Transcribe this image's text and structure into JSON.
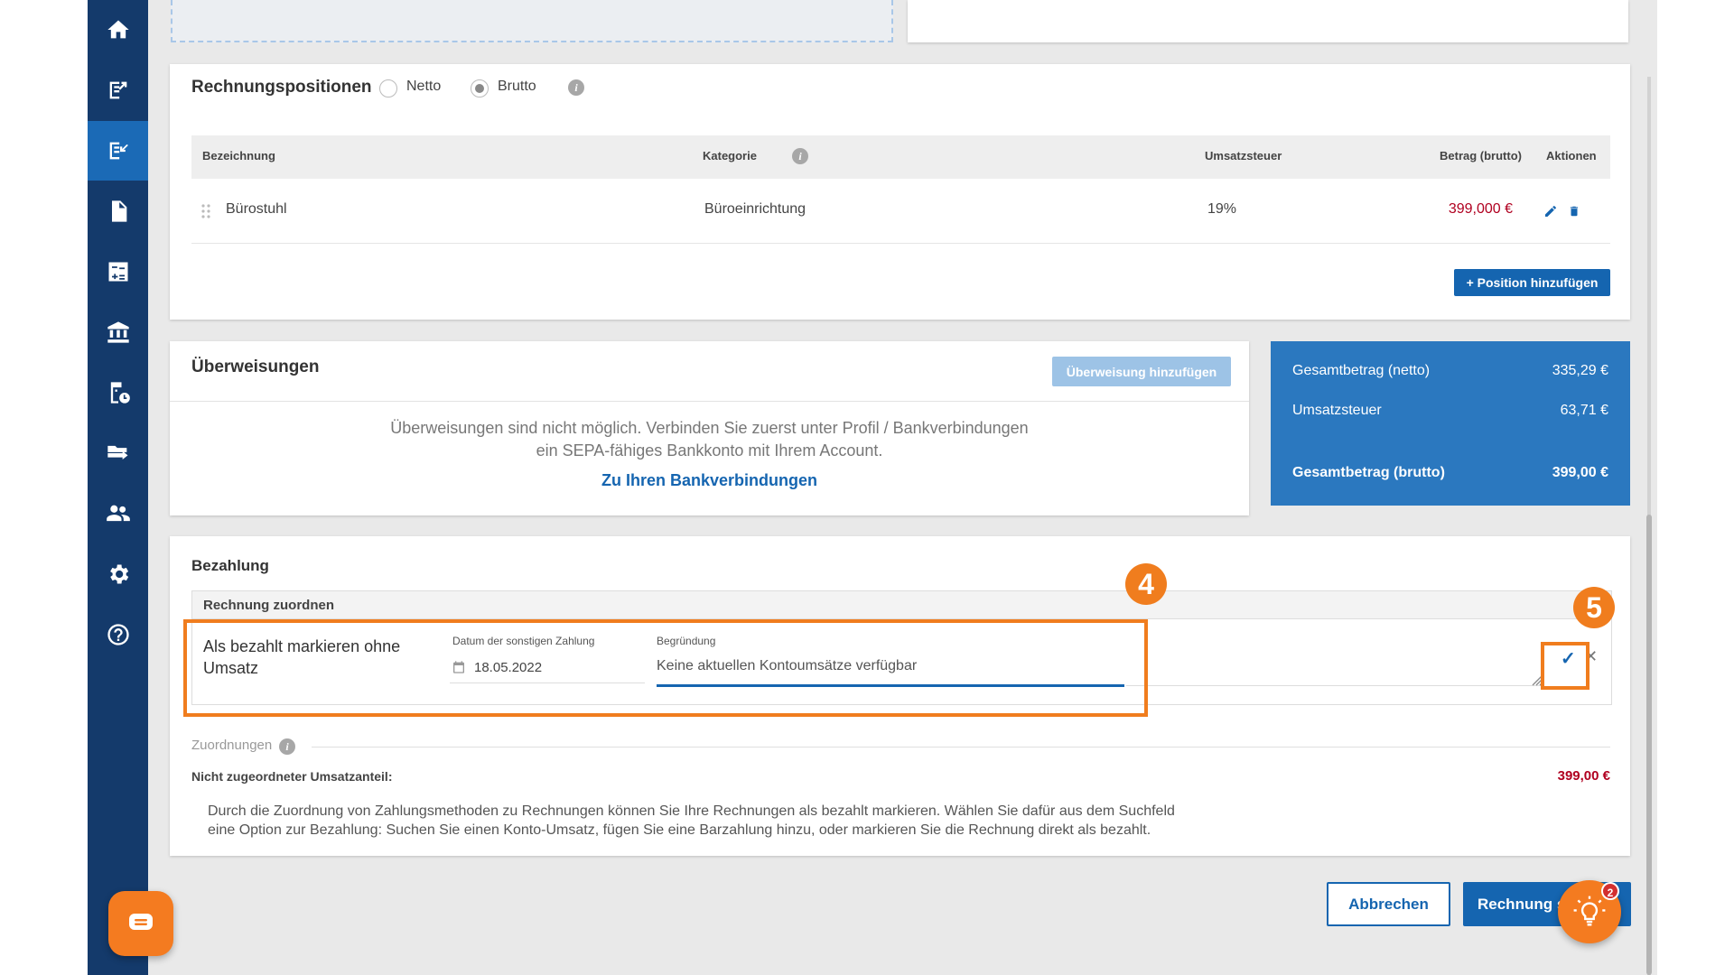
{
  "sidebar": {
    "items": [
      {
        "icon": "home-icon"
      },
      {
        "icon": "outgoing-invoice-icon"
      },
      {
        "icon": "incoming-invoice-icon",
        "active": true
      },
      {
        "icon": "document-icon"
      },
      {
        "icon": "calculator-icon"
      },
      {
        "icon": "bank-icon"
      },
      {
        "icon": "receipt-icon"
      },
      {
        "icon": "folder-icon"
      },
      {
        "icon": "users-icon"
      },
      {
        "icon": "gear-icon"
      },
      {
        "icon": "help-icon"
      }
    ]
  },
  "positions": {
    "title": "Rechnungspositionen",
    "netto_label": "Netto",
    "brutto_label": "Brutto",
    "selected_mode": "Brutto",
    "columns": {
      "bezeichnung": "Bezeichnung",
      "kategorie": "Kategorie",
      "umsatzsteuer": "Umsatzsteuer",
      "betrag": "Betrag (brutto)",
      "aktionen": "Aktionen"
    },
    "rows": [
      {
        "bezeichnung": "Bürostuhl",
        "kategorie": "Büroeinrichtung",
        "umsatzsteuer": "19%",
        "betrag": "399,000 €"
      }
    ],
    "add_button": "+ Position hinzufügen"
  },
  "transfers": {
    "title": "Überweisungen",
    "add_button": "Überweisung hinzufügen",
    "message_line1": "Überweisungen sind nicht möglich. Verbinden Sie zuerst unter Profil / Bankverbindungen",
    "message_line2": "ein SEPA-fähiges Bankkonto mit Ihrem Account.",
    "link": "Zu Ihren Bankverbindungen"
  },
  "totals": {
    "net_label": "Gesamtbetrag (netto)",
    "net_value": "335,29 €",
    "tax_label": "Umsatzsteuer",
    "tax_value": "63,71 €",
    "gross_label": "Gesamtbetrag (brutto)",
    "gross_value": "399,00 €"
  },
  "payment": {
    "title": "Bezahlung",
    "assign_label": "Rechnung zuordnen",
    "option_line1": "Als bezahlt markieren ohne",
    "option_line2": "Umsatz",
    "date_label": "Datum der sonstigen Zahlung",
    "date_value": "18.05.2022",
    "reason_label": "Begründung",
    "reason_value": "Keine aktuellen Kontoumsätze verfügbar",
    "assignments_label": "Zuordnungen",
    "unassigned_label": "Nicht zugeordneter Umsatzanteil:",
    "unassigned_value": "399,00 €",
    "help_line1": "Durch die Zuordnung von Zahlungsmethoden zu Rechnungen können Sie Ihre Rechnungen als bezahlt markieren. Wählen Sie dafür aus dem Suchfeld",
    "help_line2": "eine Option zur Bezahlung: Suchen Sie einen Konto-Umsatz, fügen Sie eine Barzahlung hinzu, oder markieren Sie die Rechnung direkt als bezahlt."
  },
  "annotations": {
    "step4": "4",
    "step5": "5"
  },
  "footer": {
    "cancel": "Abbrechen",
    "save": "Rechnung s"
  },
  "notifications": {
    "count": "2"
  },
  "colors": {
    "sidebar": "#143a6b",
    "accent": "#1565b0",
    "totals_bg": "#2b78bf",
    "highlight": "#f07d1e",
    "price": "#b00020"
  }
}
